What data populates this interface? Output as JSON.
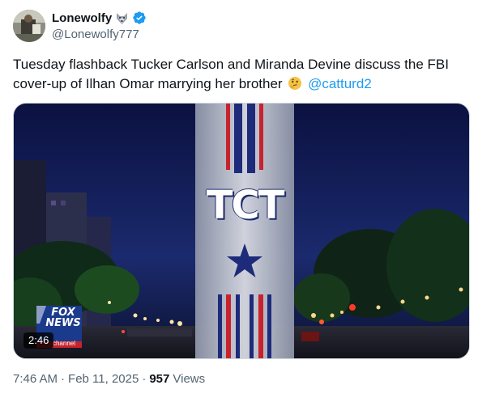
{
  "author": {
    "display_name": "Lonewolfy",
    "handle": "@Lonewolfy777",
    "avatar_icon": "avatar-image",
    "name_emoji_icon": "wolf-icon",
    "verified_icon": "verified-badge-icon",
    "verified_color": "#1d9bf0"
  },
  "tweet": {
    "text": "Tuesday flashback Tucker Carlson and Miranda Devine discuss the FBI cover-up of Ilhan Omar marrying her brother",
    "emoji_icon": "thinking-face-icon",
    "mention": "@catturd2",
    "mention_color": "#1d9bf0"
  },
  "media": {
    "type": "video",
    "duration": "2:46",
    "overlay_title": "TCT",
    "network_logo_text": "FOX NEWS",
    "network_logo_sub": "channel"
  },
  "footer": {
    "time": "7:46 AM",
    "separator": "·",
    "date": "Feb 11, 2025",
    "views_count": "957",
    "views_label": "Views"
  }
}
